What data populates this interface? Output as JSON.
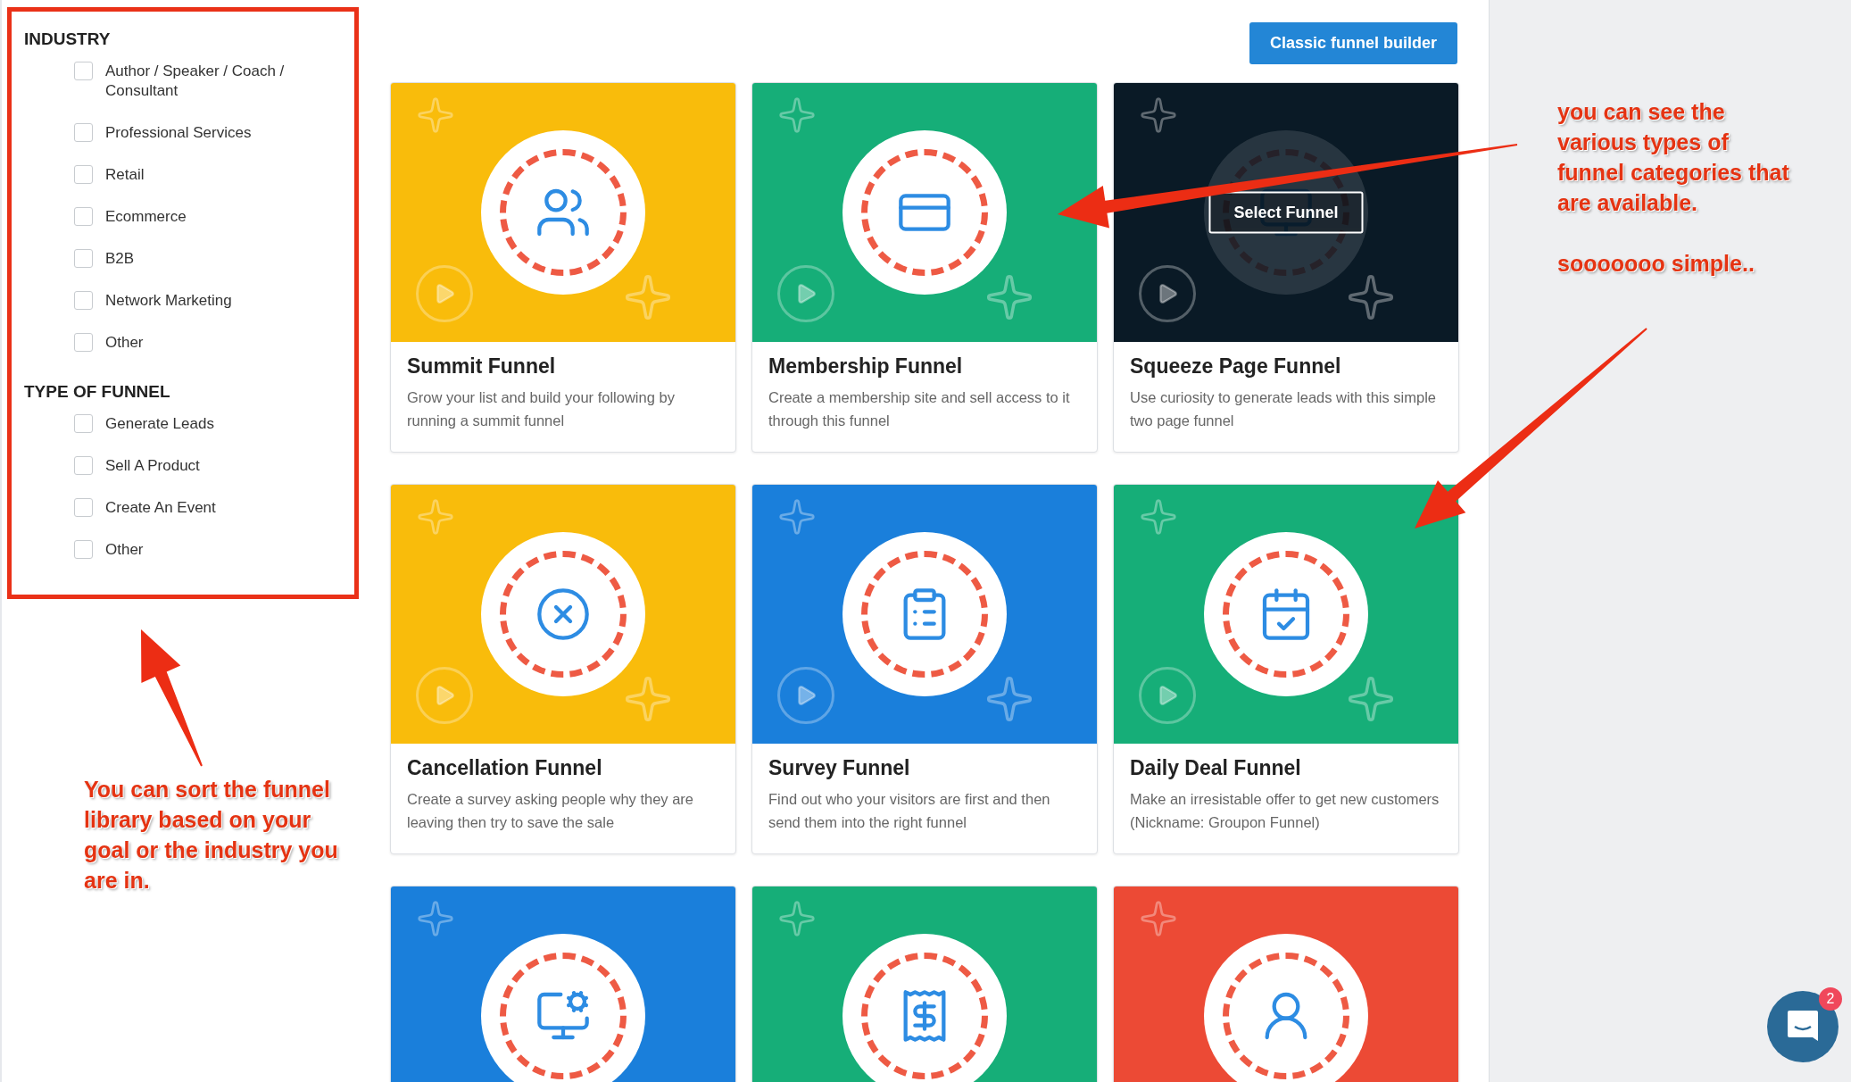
{
  "filters": [
    {
      "title": "INDUSTRY",
      "options": [
        {
          "label": "Author / Speaker / Coach / Consultant",
          "checked": false
        },
        {
          "label": "Professional Services",
          "checked": false
        },
        {
          "label": "Retail",
          "checked": false
        },
        {
          "label": "Ecommerce",
          "checked": false
        },
        {
          "label": "B2B",
          "checked": false
        },
        {
          "label": "Network Marketing",
          "checked": false
        },
        {
          "label": "Other",
          "checked": false
        }
      ]
    },
    {
      "title": "TYPE OF FUNNEL",
      "options": [
        {
          "label": "Generate Leads",
          "checked": false
        },
        {
          "label": "Sell A Product",
          "checked": false
        },
        {
          "label": "Create An Event",
          "checked": false
        },
        {
          "label": "Other",
          "checked": false
        }
      ]
    }
  ],
  "header_button": "Classic funnel builder",
  "cards": [
    {
      "title": "Summit Funnel",
      "description": "Grow your list and build your following by running a summit funnel",
      "color": "#f9bc0b",
      "hovered": false
    },
    {
      "title": "Membership Funnel",
      "description": "Create a membership site and sell access to it through this funnel",
      "color": "#16ae78",
      "hovered": false
    },
    {
      "title": "Squeeze Page Funnel",
      "description": "Use curiosity to generate leads with this simple two page funnel",
      "color": "#0a1a26",
      "hovered": true,
      "overlay_button": "Select Funnel"
    },
    {
      "title": "Cancellation Funnel",
      "description": "Create a survey asking people why they are leaving then try to save the sale",
      "color": "#f9bc0b",
      "hovered": false
    },
    {
      "title": "Survey Funnel",
      "description": "Find out who your visitors are first and then send them into the right funnel",
      "color": "#1a7fdb",
      "hovered": false
    },
    {
      "title": "Daily Deal Funnel",
      "description": "Make an irresistable offer to get new customers (Nickname: Groupon Funnel)",
      "color": "#16ae78",
      "hovered": false
    },
    {
      "color": "#1a7fdb",
      "hovered": false
    },
    {
      "color": "#16ae78",
      "hovered": false
    },
    {
      "color": "#ec4a35",
      "hovered": false
    }
  ],
  "annotations": [
    {
      "paragraphs": [
        "you can see the various types of funnel categories that are available.",
        "sooooooo simple.."
      ]
    },
    {
      "paragraphs": [
        "You can sort the funnel library based on your goal  or the industry you are in."
      ]
    }
  ],
  "chat": {
    "badge": "2"
  }
}
